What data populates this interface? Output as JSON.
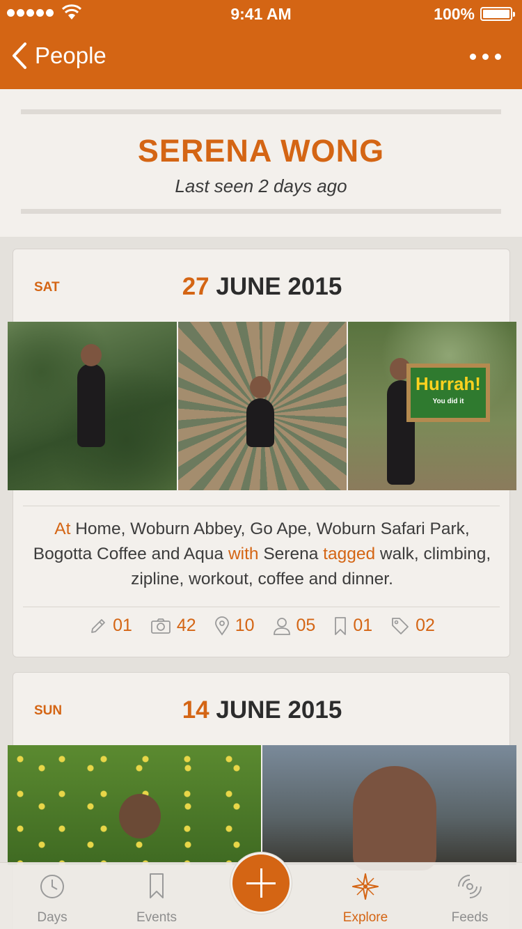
{
  "status_bar": {
    "time": "9:41 AM",
    "battery": "100%"
  },
  "nav": {
    "back_label": "People"
  },
  "profile": {
    "name": "SERENA WONG",
    "last_seen": "Last seen 2 days ago"
  },
  "entries": [
    {
      "weekday": "SAT",
      "day": "27",
      "month_year": "JUNE 2015",
      "sign_title": "Hurrah!",
      "sign_sub": "You did it",
      "description": {
        "at": "At",
        "places": " Home, Woburn Abbey, Go Ape, Woburn Safari Park, Bogotta Coffee and Aqua ",
        "with": "with",
        "people": " Serena ",
        "tagged": "tagged",
        "tags": " walk, climbing, zipline, workout, coffee and dinner."
      },
      "stats": {
        "notes": "01",
        "photos": "42",
        "places": "10",
        "people": "05",
        "events": "01",
        "tags": "02"
      }
    },
    {
      "weekday": "SUN",
      "day": "14",
      "month_year": "JUNE 2015"
    }
  ],
  "tabs": [
    {
      "label": "Days",
      "icon": "history-icon"
    },
    {
      "label": "Events",
      "icon": "bookmark-icon"
    },
    {
      "label": "Explore",
      "icon": "compass-icon",
      "active": true
    },
    {
      "label": "Feeds",
      "icon": "feed-icon"
    }
  ],
  "colors": {
    "accent": "#d46514",
    "background": "#f3f0ec"
  }
}
